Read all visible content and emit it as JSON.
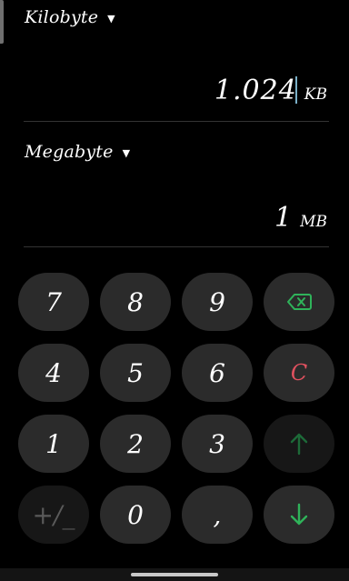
{
  "from": {
    "unit_name": "Kilobyte",
    "value": "1.024",
    "unit_symbol": "KB"
  },
  "to": {
    "unit_name": "Megabyte",
    "value": "1",
    "unit_symbol": "MB"
  },
  "keypad": {
    "row1": [
      "7",
      "8",
      "9"
    ],
    "row2": [
      "4",
      "5",
      "6"
    ],
    "row3": [
      "1",
      "2",
      "3"
    ],
    "sign_toggle": "+/_",
    "zero": "0",
    "decimal": ",",
    "clear": "C",
    "backspace_icon": "backspace-icon",
    "swap_up_icon": "arrow-up-icon",
    "swap_down_icon": "arrow-down-icon"
  },
  "colors": {
    "background": "#000000",
    "key": "#2b2b2b",
    "key_disabled": "#171717",
    "accent_green": "#2fb35a",
    "clear_red": "#e0515f"
  }
}
